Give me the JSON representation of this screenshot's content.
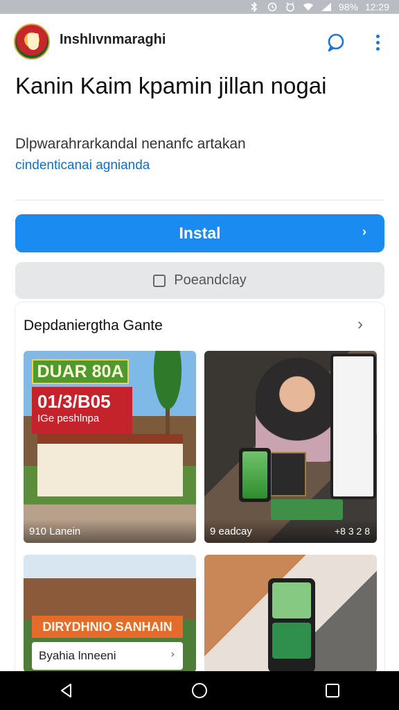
{
  "status_bar": {
    "battery": "98%",
    "time": "12:29",
    "icons": [
      "bluetooth-icon",
      "alarm-icon",
      "timer-icon",
      "wifi-icon",
      "signal-icon"
    ]
  },
  "app_bar": {
    "title": "Inshlıvnmaraghi",
    "icons": [
      "logo-icon",
      "chat-bubble-icon",
      "more-vert-icon"
    ]
  },
  "header": {
    "headline": "Kanin Kaim kpamin jillan nogai",
    "subtitle": "Dlpwarahrarkandal nenanfc artakan",
    "link_text": "cindenticanai agnianda"
  },
  "buttons": {
    "install_label": "Instal",
    "secondary_label": "Poeandclay"
  },
  "section": {
    "title": "Depdaniergtha Gante"
  },
  "tiles": [
    {
      "badge_green": "DUAR 80A",
      "badge_red_main": "01/3/B05",
      "badge_red_sub": "IGe peshlnpa",
      "caption": "910 Lanein"
    },
    {
      "caption": "9 eadcay",
      "caption_right": "+8 3 2 8"
    },
    {
      "badge_orange": "DIRYDHNIO SANHAIN",
      "caption_card": "Byahia lnneeni"
    },
    {}
  ],
  "colors": {
    "primary": "#1a8bf0",
    "secondary_bg": "#e6e7e9",
    "link": "#1170c2",
    "nav_bg": "#000000"
  }
}
